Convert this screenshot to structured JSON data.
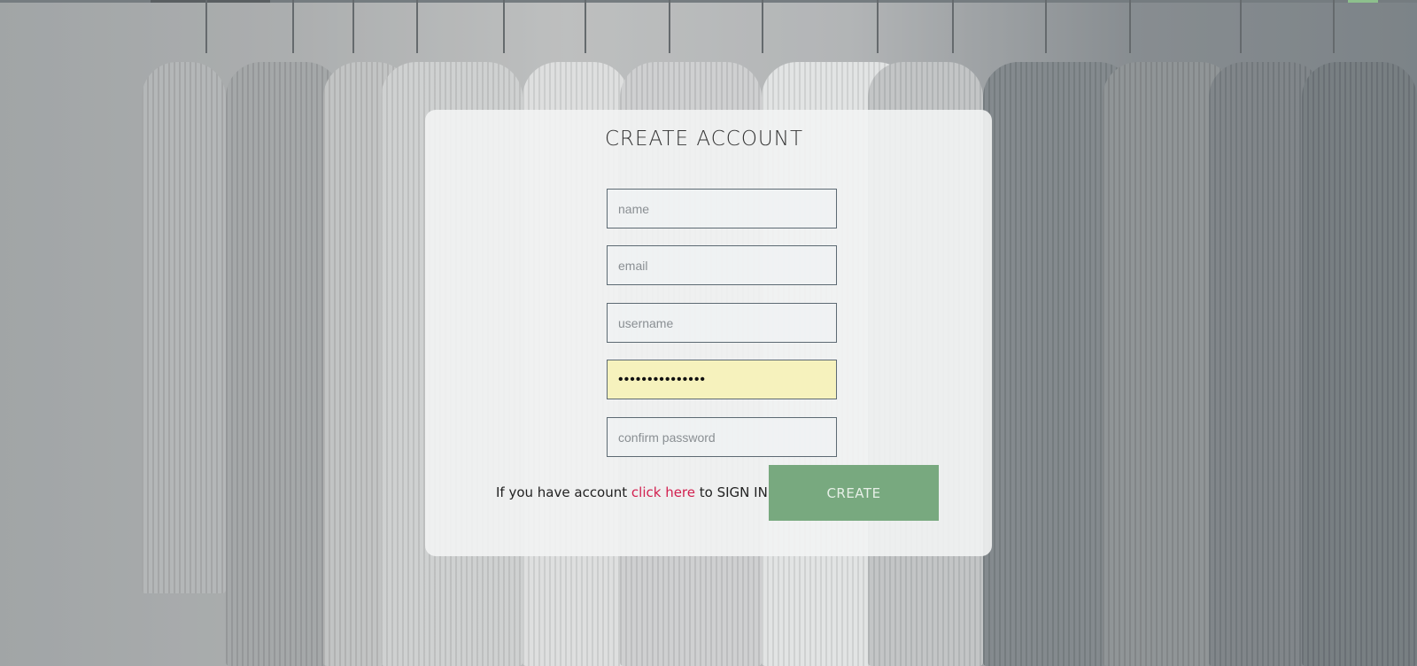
{
  "form": {
    "title": "CREATE ACCOUNT",
    "name_placeholder": "name",
    "email_placeholder": "email",
    "username_placeholder": "username",
    "password_value": "•••••••••••••••",
    "confirm_placeholder": "confirm password",
    "signin_prefix": "If you have account ",
    "signin_link": "click here",
    "signin_suffix": " to SIGN IN.",
    "create_label": "CREATE"
  },
  "colors": {
    "accent_green": "#78a97f",
    "link_red": "#d2204f",
    "autofill_yellow": "#f6f2bd"
  }
}
